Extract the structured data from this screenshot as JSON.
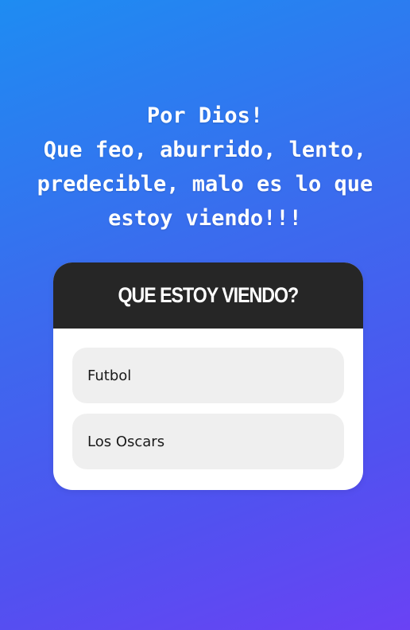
{
  "caption": {
    "lines": [
      "Por Dios!",
      "Que feo, aburrido, lento,",
      "predecible, malo es lo que",
      "estoy viendo!!!"
    ]
  },
  "quiz": {
    "question": "QUE ESTOY VIENDO?",
    "options": [
      {
        "label": "Futbol"
      },
      {
        "label": "Los Oscars"
      }
    ]
  },
  "colors": {
    "background_top": "#1e8cf2",
    "background_bottom": "#6a42f4",
    "card_header": "#262626",
    "option_bg": "#efefef"
  }
}
